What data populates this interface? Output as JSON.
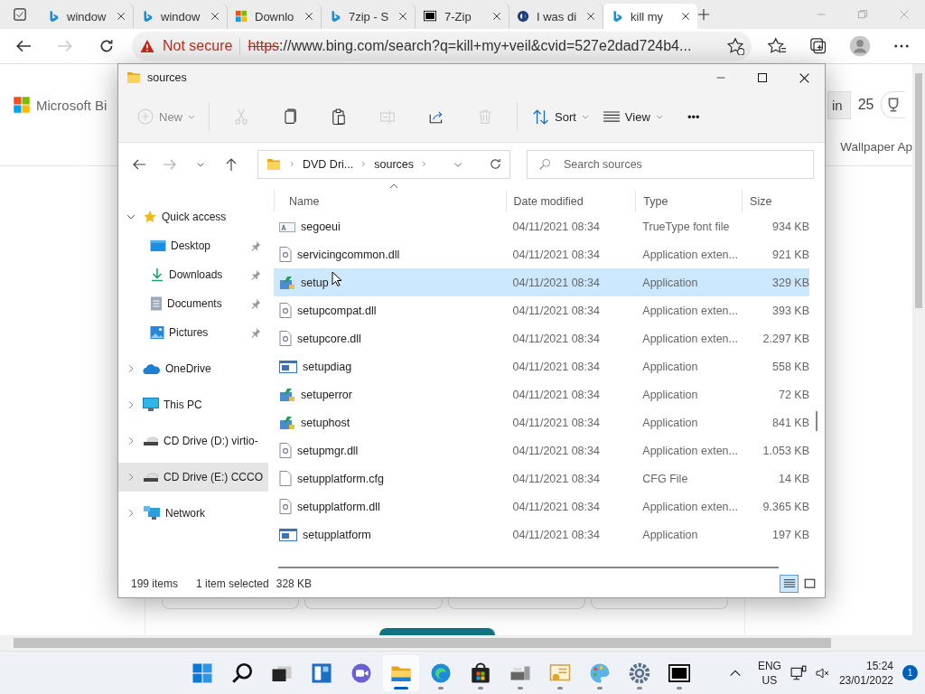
{
  "browser": {
    "tabs": [
      {
        "title": "window",
        "kind": "bing",
        "selected": false
      },
      {
        "title": "window",
        "kind": "bing",
        "selected": false
      },
      {
        "title": "Downlo",
        "kind": "microsoft",
        "selected": false
      },
      {
        "title": "7zip - S",
        "kind": "bing",
        "selected": false
      },
      {
        "title": "7-Zip",
        "kind": "sevenzip",
        "selected": false
      },
      {
        "title": "I was di",
        "kind": "circle",
        "selected": false
      },
      {
        "title": "kill my",
        "kind": "bing",
        "selected": true
      }
    ],
    "address": {
      "security": "Not secure",
      "scheme": "https",
      "rest": "://www.bing.com/search?q=kill+my+veil&cvid=527e2dad724b4..."
    }
  },
  "page": {
    "logo": "Microsoft Bi",
    "sign_in": "in",
    "points": "25",
    "nav_text": "Wallpaper Ap"
  },
  "explorer": {
    "title": "sources",
    "toolbar": [
      {
        "kind": "new",
        "label": "New",
        "disabled": true
      },
      {
        "kind": "cut",
        "disabled": true
      },
      {
        "kind": "copy",
        "disabled": false
      },
      {
        "kind": "paste",
        "disabled": false
      },
      {
        "kind": "rename",
        "disabled": true
      },
      {
        "kind": "share",
        "disabled": false
      },
      {
        "kind": "delete",
        "disabled": true
      },
      {
        "kind": "sort",
        "label": "Sort",
        "disabled": false
      },
      {
        "kind": "view",
        "label": "View",
        "disabled": false
      },
      {
        "kind": "more",
        "label": "•••",
        "disabled": false
      }
    ],
    "breadcrumb": [
      "DVD Dri...",
      "sources"
    ],
    "search": {
      "placeholder": "Search sources"
    },
    "sidebar": [
      {
        "label": "Quick access",
        "kind": "star",
        "expanded": true,
        "selected": false,
        "children": [
          {
            "label": "Desktop",
            "kind": "desktop",
            "pinned": true,
            "selected": false
          },
          {
            "label": "Downloads",
            "kind": "download",
            "pinned": true,
            "selected": false
          },
          {
            "label": "Documents",
            "kind": "document",
            "pinned": true,
            "selected": false
          },
          {
            "label": "Pictures",
            "kind": "pictures",
            "pinned": true,
            "selected": false
          }
        ]
      },
      {
        "label": "OneDrive",
        "kind": "cloud",
        "expanded": false,
        "selected": false
      },
      {
        "label": "This PC",
        "kind": "pc",
        "expanded": false,
        "selected": false
      },
      {
        "label": "CD Drive (D:) virtio-",
        "kind": "drive",
        "expanded": false,
        "selected": false
      },
      {
        "label": "CD Drive (E:) CCCO",
        "kind": "drive",
        "expanded": false,
        "selected": true
      },
      {
        "label": "Network",
        "kind": "network",
        "expanded": false,
        "selected": false
      }
    ],
    "columns": [
      "Name",
      "Date modified",
      "Type",
      "Size"
    ],
    "rows": [
      {
        "name": "segoeui",
        "date": "04/11/2021 08:34",
        "type": "TrueType font file",
        "size": "934 KB",
        "kind": "font",
        "selected": false
      },
      {
        "name": "servicingcommon.dll",
        "date": "04/11/2021 08:34",
        "type": "Application exten...",
        "size": "921 KB",
        "kind": "dll",
        "selected": false
      },
      {
        "name": "setup",
        "date": "04/11/2021 08:34",
        "type": "Application",
        "size": "329 KB",
        "kind": "installer",
        "selected": true
      },
      {
        "name": "setupcompat.dll",
        "date": "04/11/2021 08:34",
        "type": "Application exten...",
        "size": "393 KB",
        "kind": "dll",
        "selected": false
      },
      {
        "name": "setupcore.dll",
        "date": "04/11/2021 08:34",
        "type": "Application exten...",
        "size": "2.297 KB",
        "kind": "dll",
        "selected": false
      },
      {
        "name": "setupdiag",
        "date": "04/11/2021 08:34",
        "type": "Application",
        "size": "558 KB",
        "kind": "window",
        "selected": false
      },
      {
        "name": "setuperror",
        "date": "04/11/2021 08:34",
        "type": "Application",
        "size": "72 KB",
        "kind": "installer",
        "selected": false
      },
      {
        "name": "setuphost",
        "date": "04/11/2021 08:34",
        "type": "Application",
        "size": "841 KB",
        "kind": "installer",
        "selected": false
      },
      {
        "name": "setupmgr.dll",
        "date": "04/11/2021 08:34",
        "type": "Application exten...",
        "size": "1.053 KB",
        "kind": "dll",
        "selected": false
      },
      {
        "name": "setupplatform.cfg",
        "date": "04/11/2021 08:34",
        "type": "CFG File",
        "size": "14 KB",
        "kind": "blank",
        "selected": false
      },
      {
        "name": "setupplatform.dll",
        "date": "04/11/2021 08:34",
        "type": "Application exten...",
        "size": "9.365 KB",
        "kind": "dll",
        "selected": false
      },
      {
        "name": "setupplatform",
        "date": "04/11/2021 08:34",
        "type": "Application",
        "size": "197 KB",
        "kind": "window",
        "selected": false
      }
    ],
    "status": {
      "count": "199 items",
      "selection": "1 item selected",
      "size": "328 KB"
    },
    "view_buttons": [
      {
        "kind": "details",
        "selected": true
      },
      {
        "kind": "tiles",
        "selected": false
      }
    ]
  },
  "taskbar": {
    "apps": [
      {
        "kind": "start",
        "running": false,
        "selected": false
      },
      {
        "kind": "search",
        "running": false,
        "selected": false
      },
      {
        "kind": "taskview",
        "running": false,
        "selected": false
      },
      {
        "kind": "widgets",
        "running": false,
        "selected": false
      },
      {
        "kind": "chat",
        "running": false,
        "selected": false
      },
      {
        "kind": "explorer",
        "running": true,
        "selected": true
      },
      {
        "kind": "edge",
        "running": true,
        "selected": false
      },
      {
        "kind": "store",
        "running": true,
        "selected": false
      },
      {
        "kind": "devices",
        "running": true,
        "selected": false
      },
      {
        "kind": "certificate",
        "running": true,
        "selected": false
      },
      {
        "kind": "paint",
        "running": true,
        "selected": false
      },
      {
        "kind": "settings",
        "running": true,
        "selected": false
      },
      {
        "kind": "sevenzip",
        "running": true,
        "selected": false
      }
    ],
    "language": "ENG",
    "region": "US",
    "time": "15:24",
    "date": "23/01/2022",
    "notifications": "1"
  }
}
